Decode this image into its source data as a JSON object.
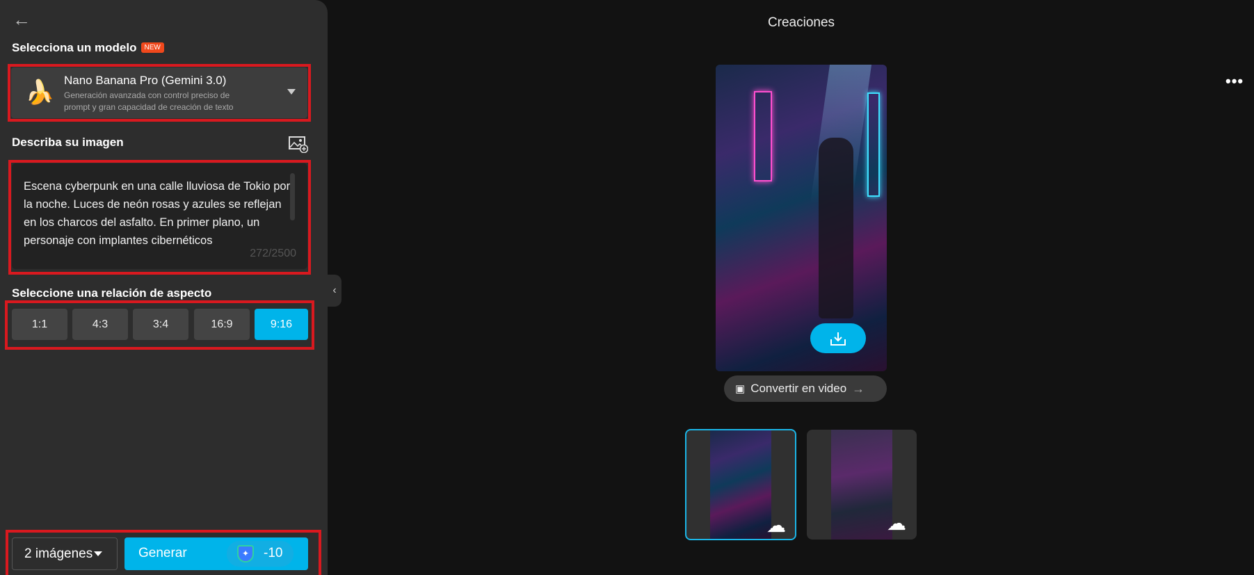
{
  "sidebar": {
    "model_heading": "Selecciona un modelo",
    "new_badge": "NEW",
    "model": {
      "name": "Nano Banana Pro (Gemini 3.0)",
      "description": "Generación avanzada con control preciso de prompt y gran capacidad de creación de texto",
      "icon": "banana-icon"
    },
    "describe_heading": "Describa su imagen",
    "prompt": "Escena cyberpunk en una calle lluviosa de Tokio por la noche. Luces de neón rosas y azules se reflejan en los charcos del asfalto. En primer plano, un personaje con implantes cibernéticos",
    "char_count": "272/2500",
    "aspect_heading": "Seleccione una relación de aspecto",
    "aspect_ratios": [
      "1:1",
      "4:3",
      "3:4",
      "16:9",
      "9:16"
    ],
    "selected_aspect": "9:16",
    "image_count": "2 imágenes",
    "generate_label": "Generar",
    "credits": "-10"
  },
  "main": {
    "title": "Creaciones",
    "convert_label": "Convertir en video"
  },
  "colors": {
    "accent": "#00b4ea",
    "panel": "#2d2d2d",
    "background": "#121212",
    "highlight": "#d9191f"
  }
}
